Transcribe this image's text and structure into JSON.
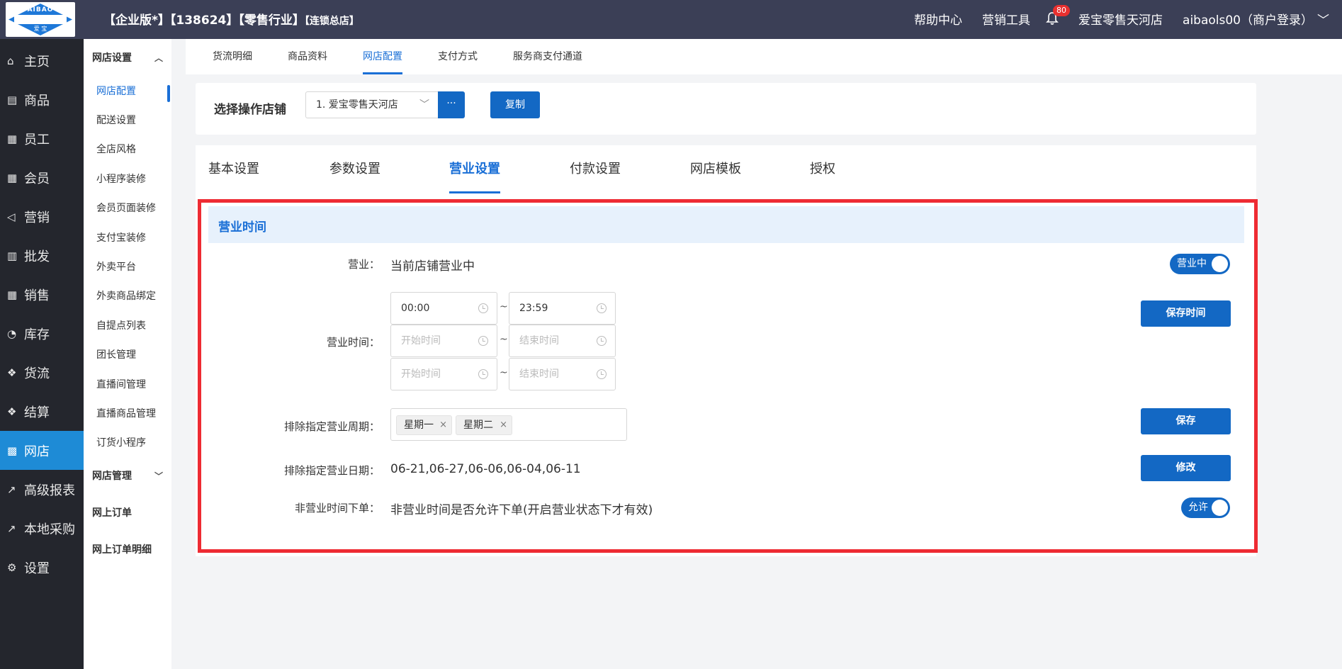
{
  "header": {
    "logo_en": "AIBAO",
    "logo_cn": "爱 宝",
    "title_main": "【企业版*】【138624】【零售行业】",
    "title_small": "【连锁总店】",
    "help": "帮助中心",
    "marketing_tools": "营销工具",
    "notification_count": "80",
    "store_name": "爱宝零售天河店",
    "user": "aibaols00（商户登录）"
  },
  "leftnav": {
    "items": [
      {
        "label": "主页",
        "icon": "home-icon"
      },
      {
        "label": "商品",
        "icon": "box-icon"
      },
      {
        "label": "员工",
        "icon": "staff-icon"
      },
      {
        "label": "会员",
        "icon": "member-icon"
      },
      {
        "label": "营销",
        "icon": "megaphone-icon"
      },
      {
        "label": "批发",
        "icon": "list-icon"
      },
      {
        "label": "销售",
        "icon": "chart-icon"
      },
      {
        "label": "库存",
        "icon": "pie-icon"
      },
      {
        "label": "货流",
        "icon": "cube-icon"
      },
      {
        "label": "结算",
        "icon": "settle-icon"
      },
      {
        "label": "网店",
        "icon": "shop-icon"
      },
      {
        "label": "高级报表",
        "icon": "trend-icon"
      },
      {
        "label": "本地采购",
        "icon": "trend-icon"
      },
      {
        "label": "设置",
        "icon": "gear-icon"
      }
    ],
    "active": "网店"
  },
  "subnav": {
    "group1": "网店设置",
    "items": [
      "网店配置",
      "配送设置",
      "全店风格",
      "小程序装修",
      "会员页面装修",
      "支付宝装修",
      "外卖平台",
      "外卖商品绑定",
      "自提点列表",
      "团长管理",
      "直播间管理",
      "直播商品管理",
      "订货小程序"
    ],
    "active": "网店配置",
    "group2": "网店管理",
    "group2_items": [
      "网上订单",
      "网上订单明细"
    ]
  },
  "toptabs": {
    "items": [
      "货流明细",
      "商品资料",
      "网店配置",
      "支付方式",
      "服务商支付通道"
    ],
    "active": "网店配置"
  },
  "store_selector": {
    "label": "选择操作店铺",
    "value": "1. 爱宝零售天河店",
    "more": "···",
    "copy": "复制"
  },
  "settings_tabs": {
    "items": [
      "基本设置",
      "参数设置",
      "营业设置",
      "付款设置",
      "网店模板",
      "授权"
    ],
    "active": "营业设置"
  },
  "business": {
    "section_title": "营业时间",
    "status_label": "营业：",
    "status_text": "当前店铺营业中",
    "status_toggle": "营业中",
    "hours_label": "营业时间：",
    "slots": [
      {
        "start": "00:00",
        "end": "23:59"
      },
      {
        "start": "",
        "end": ""
      },
      {
        "start": "",
        "end": ""
      }
    ],
    "start_placeholder": "开始时间",
    "end_placeholder": "结束时间",
    "tilde": "~",
    "save_time": "保存时间",
    "exclude_week_label": "排除指定营业周期：",
    "exclude_week_tags": [
      "星期一",
      "星期二"
    ],
    "tag_close": "×",
    "save": "保存",
    "exclude_date_label": "排除指定营业日期：",
    "exclude_dates": "06-21,06-27,06-06,06-04,06-11",
    "modify": "修改",
    "offhours_label": "非营业时间下单：",
    "offhours_text": "非营业时间是否允许下单(开启营业状态下才有效)",
    "offhours_toggle": "允许"
  },
  "colors": {
    "topbar": "#3b3f56",
    "leftnav": "#24262d",
    "active_nav": "#1e8bd6",
    "primary": "#1368c4",
    "highlight_border": "#ee2b33"
  }
}
